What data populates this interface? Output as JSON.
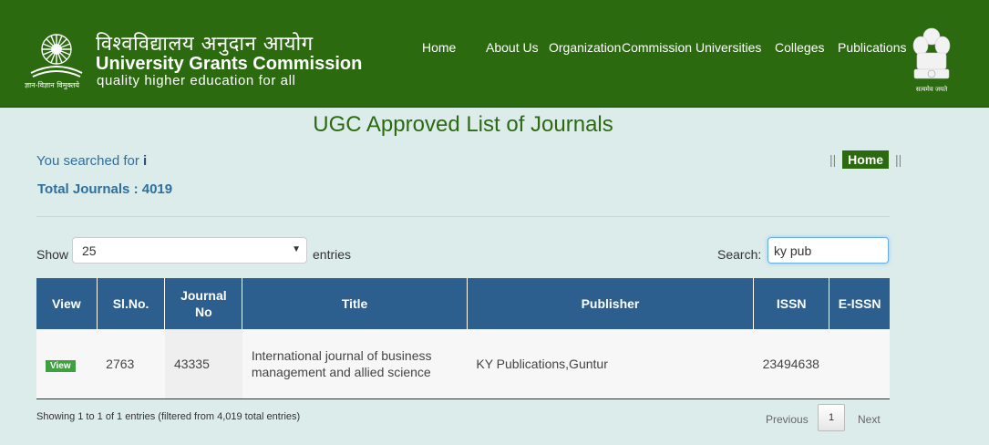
{
  "header": {
    "hindi_name": "विश्वविद्यालय अनुदान आयोग",
    "name": "University Grants Commission",
    "tagline": "quality higher education for all",
    "motto": "ज्ञान-विज्ञान विमुक्तये",
    "right_emblem_text": "सत्यमेव जयते",
    "nav": [
      "Home",
      "About Us",
      "Organization",
      "Commission",
      "Universities",
      "Colleges",
      "Publications"
    ]
  },
  "page_title": "UGC Approved List of Journals",
  "search_summary": {
    "prefix": "You searched for",
    "term": "i"
  },
  "total_journals": "Total Journals : 4019",
  "home_link": "Home",
  "separator": "||",
  "controls": {
    "show_label": "Show",
    "page_size": "25",
    "entries_label": "entries",
    "search_label": "Search:",
    "search_value": "ky pub"
  },
  "table": {
    "columns": [
      "View",
      "Sl.No.",
      "Journal No",
      "Title",
      "Publisher",
      "ISSN",
      "E-ISSN"
    ],
    "rows": [
      {
        "view": "View",
        "sl_no": "2763",
        "journal_no": "43335",
        "title": "International journal of business management and allied science",
        "publisher": "KY Publications,Guntur",
        "issn": "23494638",
        "eissn": ""
      }
    ]
  },
  "footer": {
    "info": "Showing 1 to 1 of 1 entries (filtered from 4,019 total entries)",
    "previous": "Previous",
    "current_page": "1",
    "next": "Next"
  },
  "colors": {
    "header_green": "#2c6a10",
    "table_header_blue": "#2c5f8d",
    "page_background": "#dcecea"
  }
}
